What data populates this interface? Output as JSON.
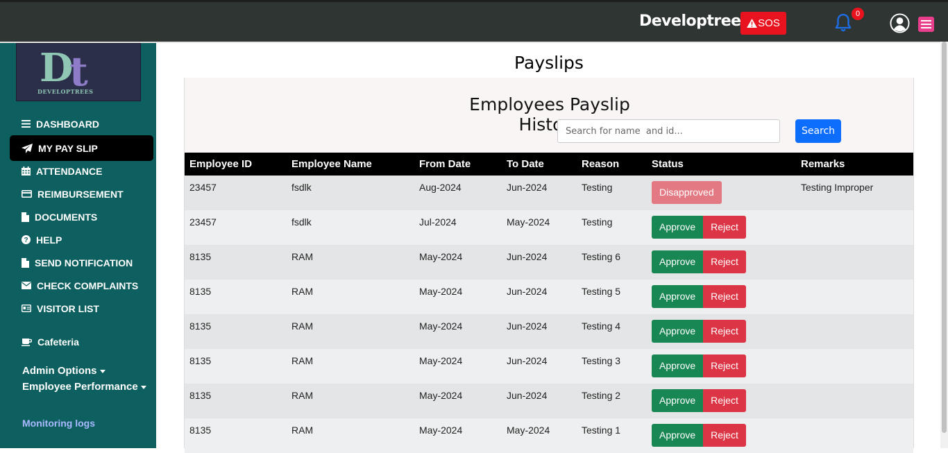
{
  "topbar": {
    "brand": "Developtrees",
    "sos_label": "SOS",
    "notification_count": "0"
  },
  "sidebar": {
    "logo_text": "DEVELOPTREES",
    "items": [
      {
        "label": "DASHBOARD",
        "icon": "list-icon"
      },
      {
        "label": "MY PAY SLIP",
        "icon": "paper-plane-icon"
      },
      {
        "label": "ATTENDANCE",
        "icon": "calendar-icon"
      },
      {
        "label": "REIMBURSEMENT",
        "icon": "credit-card-icon"
      },
      {
        "label": "DOCUMENTS",
        "icon": "file-icon"
      },
      {
        "label": "HELP",
        "icon": "question-circle-icon"
      },
      {
        "label": "SEND NOTIFICATION",
        "icon": "file-icon"
      },
      {
        "label": "CHECK COMPLAINTS",
        "icon": "envelope-icon"
      },
      {
        "label": "VISITOR LIST",
        "icon": "id-card-icon"
      }
    ],
    "cafeteria": "Cafeteria",
    "admin_options": "Admin Options",
    "employee_performance": "Employee Performance",
    "monitoring_logs": "Monitoring logs"
  },
  "main": {
    "title": "Payslips",
    "card_title": "Employees Payslip History",
    "search_placeholder": "Search for name  and id...",
    "search_button": "Search",
    "columns": [
      "Employee ID",
      "Employee Name",
      "From Date",
      "To Date",
      "Reason",
      "Status",
      "Remarks"
    ],
    "approve_label": "Approve",
    "reject_label": "Reject",
    "rows": [
      {
        "id": "23457",
        "name": "fsdlk",
        "from": "Aug-2024",
        "to": "Jun-2024",
        "reason": "Testing",
        "status": "Disapproved",
        "remarks": "Testing Improper"
      },
      {
        "id": "23457",
        "name": "fsdlk",
        "from": "Jul-2024",
        "to": "May-2024",
        "reason": "Testing",
        "status": "pending",
        "remarks": ""
      },
      {
        "id": "8135",
        "name": "RAM",
        "from": "May-2024",
        "to": "Jun-2024",
        "reason": "Testing 6",
        "status": "pending",
        "remarks": ""
      },
      {
        "id": "8135",
        "name": "RAM",
        "from": "May-2024",
        "to": "Jun-2024",
        "reason": "Testing 5",
        "status": "pending",
        "remarks": ""
      },
      {
        "id": "8135",
        "name": "RAM",
        "from": "May-2024",
        "to": "Jun-2024",
        "reason": "Testing 4",
        "status": "pending",
        "remarks": ""
      },
      {
        "id": "8135",
        "name": "RAM",
        "from": "May-2024",
        "to": "Jun-2024",
        "reason": "Testing 3",
        "status": "pending",
        "remarks": ""
      },
      {
        "id": "8135",
        "name": "RAM",
        "from": "May-2024",
        "to": "Jun-2024",
        "reason": "Testing 2",
        "status": "pending",
        "remarks": ""
      },
      {
        "id": "8135",
        "name": "RAM",
        "from": "May-2024",
        "to": "May-2024",
        "reason": "Testing 1",
        "status": "pending",
        "remarks": ""
      }
    ]
  },
  "colors": {
    "topbar": "#2e3532",
    "sidebar": "#0e6060",
    "sos": "#e8131e",
    "search_button": "#0d6efd",
    "approve": "#198754",
    "reject": "#dc3545",
    "disapproved": "#e37982"
  }
}
